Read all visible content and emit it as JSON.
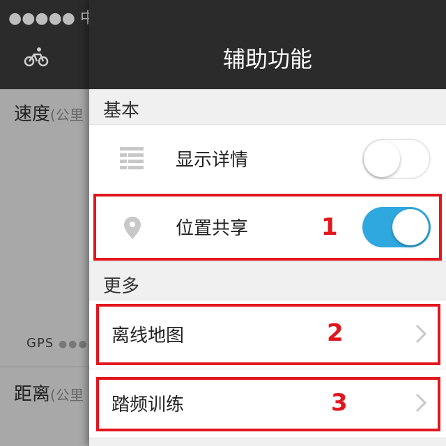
{
  "background": {
    "status_text": "●●●●● 中国",
    "speed_label": "速度",
    "speed_unit": "(公里",
    "gps_label": "GPS",
    "gps_dots": "●●●●",
    "distance_label": "距离",
    "distance_unit": "(公里"
  },
  "drawer": {
    "title": "辅助功能",
    "sections": {
      "basic": "基本",
      "more": "更多"
    },
    "rows": {
      "show_details": {
        "label": "显示详情",
        "icon": "list-icon",
        "toggle_on": false
      },
      "location_share": {
        "label": "位置共享",
        "icon": "location-pin-icon",
        "toggle_on": true
      },
      "offline_map": {
        "label": "离线地图",
        "icon": "chevron-right-icon"
      },
      "cadence_training": {
        "label": "踏频训练",
        "icon": "chevron-right-icon"
      }
    }
  },
  "annotations": [
    "1",
    "2",
    "3"
  ],
  "colors": {
    "header_bg": "#2b2b2b",
    "toggle_on": "#2ea8df",
    "annotation": "#e2161e"
  }
}
